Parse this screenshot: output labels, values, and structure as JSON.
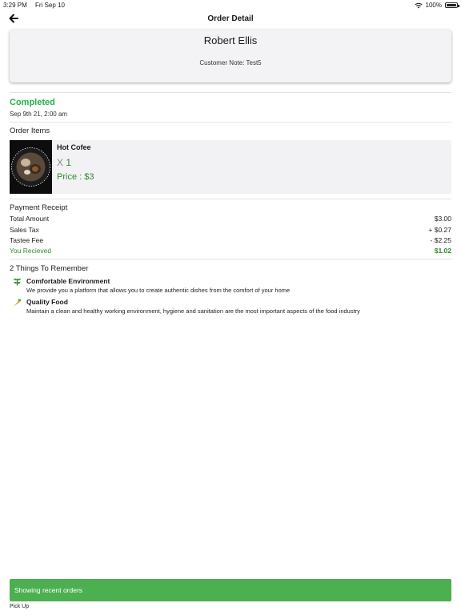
{
  "status_bar": {
    "time": "3:29 PM",
    "date": "Fri Sep 10",
    "battery": "100%"
  },
  "nav": {
    "title": "Order Detail",
    "back_icon": "arrow-left-icon"
  },
  "customer": {
    "name": "Robert Ellis",
    "note": "Customer Note: Test5"
  },
  "order": {
    "status": "Completed",
    "date": "Sep 9th 21, 2:00 am",
    "status_color": "#22b14c"
  },
  "items_section": {
    "title": "Order Items"
  },
  "items": [
    {
      "name": "Hot Cofee",
      "qty_prefix": "X",
      "qty": "1",
      "price": "Price : $3"
    }
  ],
  "receipt": {
    "title": "Payment Receipt",
    "rows": [
      {
        "label": "Total Amount",
        "value": "$3.00"
      },
      {
        "label": "Sales Tax",
        "value": "+ $0.27"
      },
      {
        "label": "Tastee Fee",
        "value": "- $2.25"
      },
      {
        "label": "You Recieved",
        "value": "$1.02"
      }
    ]
  },
  "remember": {
    "title": "2 Things To Remember",
    "tips": [
      {
        "icon": "leaf-icon",
        "title": "Comfortable Environment",
        "desc": "We provide you a platform that allows you to create authentic dishes from the comfort of your home"
      },
      {
        "icon": "carrot-icon",
        "title": "Quality Food",
        "desc": "Maintain a clean and healthy working environment, hygiene and sanitation are the most important aspects of the food industry"
      }
    ]
  },
  "toast": {
    "text": "Showing recent orders",
    "color": "#4caf50"
  },
  "bottom": {
    "label": "Pick Up"
  }
}
